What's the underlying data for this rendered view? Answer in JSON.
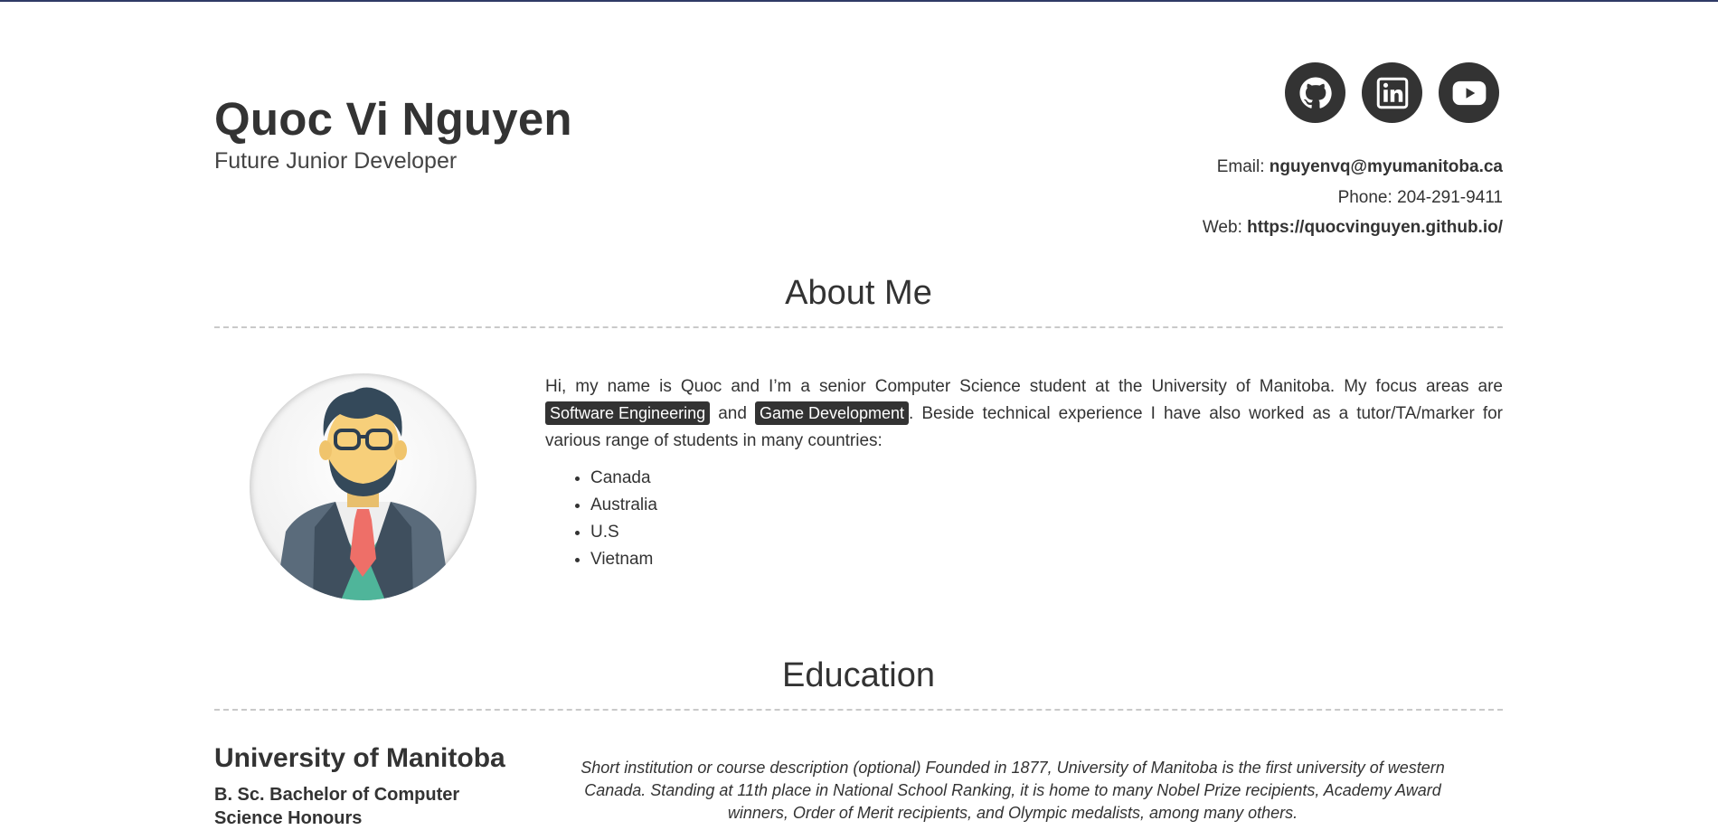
{
  "header": {
    "name": "Quoc Vi Nguyen",
    "subtitle": "Future Junior Developer",
    "social": [
      {
        "icon": "github-icon",
        "label": "GitHub"
      },
      {
        "icon": "linkedin-icon",
        "label": "LinkedIn"
      },
      {
        "icon": "youtube-icon",
        "label": "YouTube"
      }
    ],
    "contact": {
      "email_label": "Email:",
      "email_value": "nguyenvq@myumanitoba.ca",
      "phone_label": "Phone:",
      "phone_value": "204-291-9411",
      "web_label": "Web:",
      "web_value": "https://quocvinguyen.github.io/"
    }
  },
  "about": {
    "title": "About Me",
    "text_before": "Hi, my name is Quoc and I’m a senior Computer Science student at the University of Manitoba. My focus areas are",
    "tag1": "Software Engineering",
    "and_word": "and",
    "tag2": "Game Development",
    "text_after": ". Beside technical experience I have also worked as a tutor/TA/marker for various range of students in many countries:",
    "countries": [
      "Canada",
      "Australia",
      "U.S",
      "Vietnam"
    ]
  },
  "education": {
    "title": "Education",
    "school": "University of Manitoba",
    "degree": "B. Sc. Bachelor of Computer Science Honours",
    "description": "Short institution or course description (optional) Founded in 1877, University of Manitoba is the first university of western Canada. Standing at 11th place in National School Ranking, it is home to many Nobel Prize recipients, Academy Award winners, Order of Merit recipients, and Olympic medalists, among many others."
  },
  "colors": {
    "accent_dark": "#333333",
    "top_border": "#2f3a66",
    "rule": "#c9c9c9"
  }
}
